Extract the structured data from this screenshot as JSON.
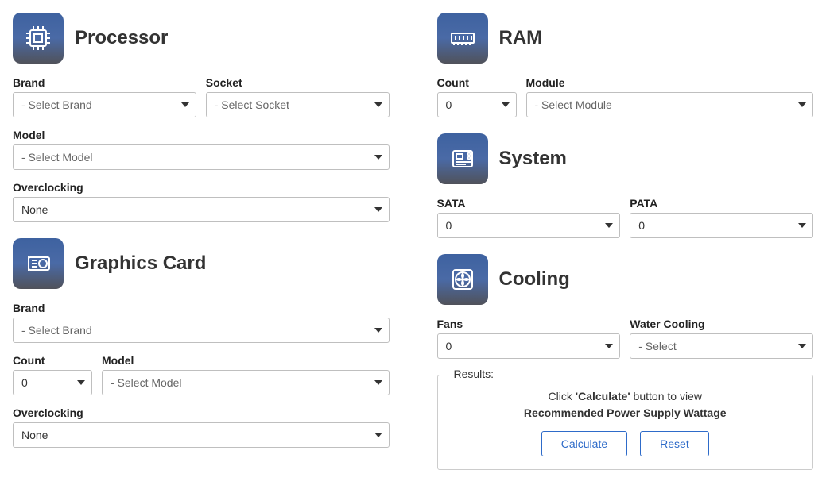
{
  "processor": {
    "title": "Processor",
    "brand": {
      "label": "Brand",
      "value": "- Select Brand"
    },
    "socket": {
      "label": "Socket",
      "value": "- Select Socket"
    },
    "model": {
      "label": "Model",
      "value": "- Select Model"
    },
    "overclocking": {
      "label": "Overclocking",
      "value": "None"
    }
  },
  "gpu": {
    "title": "Graphics Card",
    "brand": {
      "label": "Brand",
      "value": "- Select Brand"
    },
    "count": {
      "label": "Count",
      "value": "0"
    },
    "model": {
      "label": "Model",
      "value": "- Select Model"
    },
    "overclocking": {
      "label": "Overclocking",
      "value": "None"
    }
  },
  "ram": {
    "title": "RAM",
    "count": {
      "label": "Count",
      "value": "0"
    },
    "module": {
      "label": "Module",
      "value": "- Select Module"
    }
  },
  "system": {
    "title": "System",
    "sata": {
      "label": "SATA",
      "value": "0"
    },
    "pata": {
      "label": "PATA",
      "value": "0"
    }
  },
  "cooling": {
    "title": "Cooling",
    "fans": {
      "label": "Fans",
      "value": "0"
    },
    "water": {
      "label": "Water Cooling",
      "value": "- Select"
    }
  },
  "results": {
    "legend": "Results:",
    "line1_pre": "Click ",
    "line1_bold": "'Calculate'",
    "line1_post": " button to view",
    "line2": "Recommended Power Supply Wattage",
    "calculate": "Calculate",
    "reset": "Reset"
  }
}
